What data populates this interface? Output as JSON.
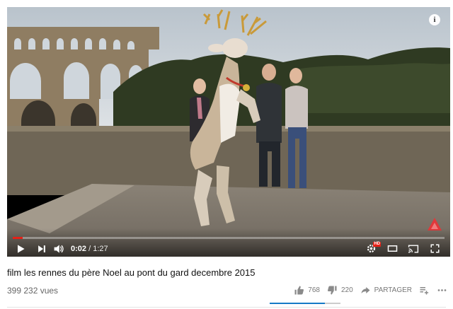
{
  "video": {
    "current_time": "0:02",
    "separator": " / ",
    "duration": "1:27",
    "progress_fraction": 0.023,
    "hd_badge": "HD"
  },
  "info": {
    "glyph": "i"
  },
  "details": {
    "title": "film les rennes du père Noel au pont du gard decembre 2015",
    "views": "399 232 vues",
    "likes": "768",
    "dislikes": "220",
    "share_label": "PARTAGER",
    "like_ratio": 0.777
  },
  "colors": {
    "progress": "#e62117",
    "like_bar": "#167ac6",
    "dislike_bar": "#cccccc"
  },
  "icons": [
    "play-icon",
    "next-icon",
    "volume-icon",
    "settings-icon",
    "theater-icon",
    "cast-icon",
    "fullscreen-icon",
    "like-icon",
    "dislike-icon",
    "share-icon",
    "add-to-playlist-icon",
    "more-icon"
  ]
}
